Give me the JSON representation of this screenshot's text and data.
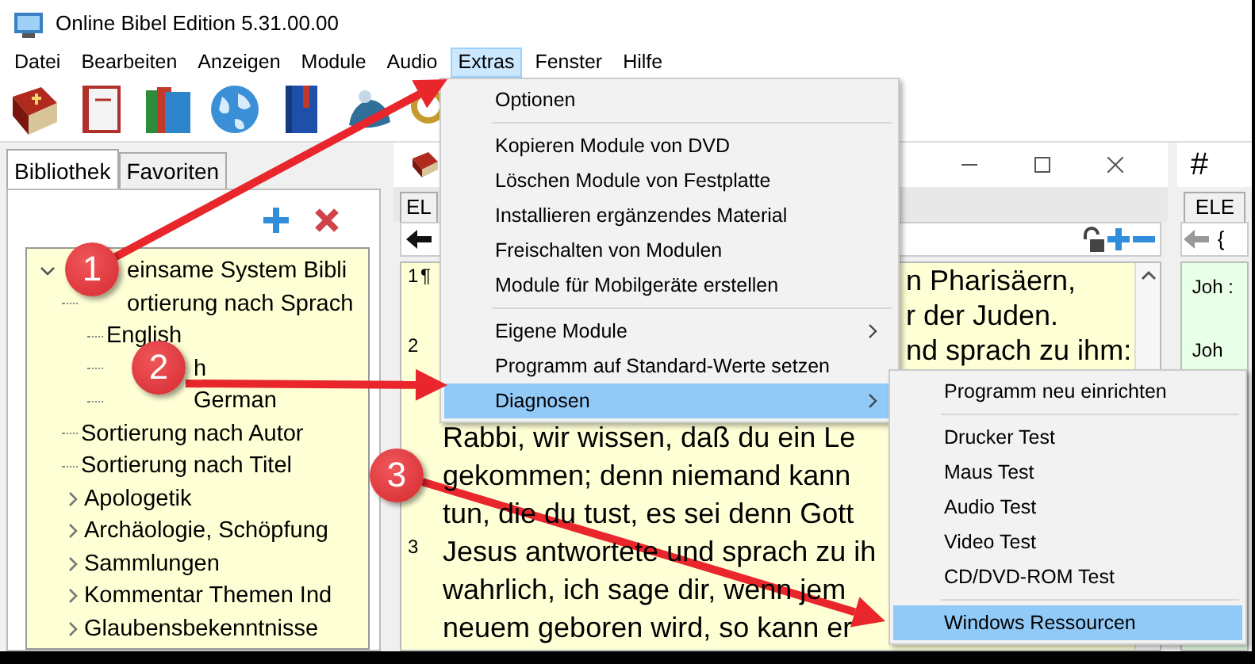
{
  "window": {
    "title": "Online Bibel Edition 5.31.00.00"
  },
  "menu_bar": [
    {
      "label": "Datei",
      "selected": false
    },
    {
      "label": "Bearbeiten",
      "selected": false
    },
    {
      "label": "Anzeigen",
      "selected": false
    },
    {
      "label": "Module",
      "selected": false
    },
    {
      "label": "Audio",
      "selected": false
    },
    {
      "label": "Extras",
      "selected": true
    },
    {
      "label": "Fenster",
      "selected": false
    },
    {
      "label": "Hilfe",
      "selected": false
    }
  ],
  "library_panel": {
    "tabs": [
      {
        "label": "Bibliothek",
        "selected": true
      },
      {
        "label": "Favoriten",
        "selected": false
      }
    ],
    "tree": [
      {
        "label": "einsame System Bibli",
        "expanded": true,
        "children": [
          {
            "label": "ortierung nach Sprach",
            "children": [
              {
                "label": "English"
              },
              {
                "label": "h"
              },
              {
                "label": "German"
              }
            ]
          },
          {
            "label": "Sortierung nach Autor"
          },
          {
            "label": "Sortierung nach Titel"
          },
          {
            "label": "Apologetik",
            "expanded": false
          },
          {
            "label": "Archäologie, Schöpfung",
            "expanded": false
          },
          {
            "label": "Sammlungen",
            "expanded": false
          },
          {
            "label": "Kommentar Themen Ind",
            "expanded": false
          },
          {
            "label": "Glaubensbekenntnisse",
            "expanded": false
          }
        ]
      }
    ]
  },
  "bible_window": {
    "tab": "EL",
    "lines": [
      {
        "number": "1",
        "left": "¶",
        "right": "n Pharisäern,"
      },
      {
        "right": "r  der Juden."
      },
      {
        "number": "2",
        "right": "nd sprach zu ihm:"
      },
      {
        "left": "Rabbi, wir wissen, daß  du ein Le"
      },
      {
        "left": "gekommen; denn niemand kann"
      },
      {
        "left": "tun, die du tust, es sei denn Gott"
      },
      {
        "number": "3",
        "left": "Jesus antwortete und sprach zu ih"
      },
      {
        "left": "wahrlich, ich sage dir, wenn jem"
      },
      {
        "left": "neuem geboren wird, so kann er"
      }
    ]
  },
  "right_window": {
    "header": "#",
    "tab": "ELE",
    "toolbar_text": "{",
    "rows": [
      "Joh :",
      "Joh"
    ]
  },
  "extras_menu": [
    {
      "kind": "item",
      "label": "Optionen",
      "submenu": false,
      "selected": false
    },
    {
      "kind": "separator"
    },
    {
      "kind": "item",
      "label": "Kopieren Module von DVD",
      "submenu": false,
      "selected": false
    },
    {
      "kind": "item",
      "label": "Löschen Module von Festplatte",
      "submenu": false,
      "selected": false
    },
    {
      "kind": "item",
      "label": "Installieren ergänzendes Material",
      "submenu": false,
      "selected": false
    },
    {
      "kind": "item",
      "label": "Freischalten von Modulen",
      "submenu": false,
      "selected": false
    },
    {
      "kind": "item",
      "label": "Module für Mobilgeräte erstellen",
      "submenu": false,
      "selected": false
    },
    {
      "kind": "separator"
    },
    {
      "kind": "item",
      "label": "Eigene Module",
      "submenu": true,
      "selected": false
    },
    {
      "kind": "item",
      "label": "Programm auf Standard-Werte setzen",
      "submenu": false,
      "selected": false
    },
    {
      "kind": "item",
      "label": "Diagnosen",
      "submenu": true,
      "selected": true
    }
  ],
  "diagnosen_menu": [
    {
      "kind": "item",
      "label": "Programm neu einrichten",
      "submenu": false,
      "selected": false
    },
    {
      "kind": "separator"
    },
    {
      "kind": "item",
      "label": "Drucker Test",
      "submenu": false,
      "selected": false
    },
    {
      "kind": "item",
      "label": "Maus Test",
      "submenu": false,
      "selected": false
    },
    {
      "kind": "item",
      "label": "Audio Test",
      "submenu": false,
      "selected": false
    },
    {
      "kind": "item",
      "label": "Video Test",
      "submenu": false,
      "selected": false
    },
    {
      "kind": "item",
      "label": "CD/DVD-ROM Test",
      "submenu": false,
      "selected": false
    },
    {
      "kind": "separator"
    },
    {
      "kind": "item",
      "label": "Windows Ressourcen",
      "submenu": false,
      "selected": true
    }
  ],
  "callouts": [
    {
      "number": "1"
    },
    {
      "number": "2"
    },
    {
      "number": "3"
    }
  ]
}
